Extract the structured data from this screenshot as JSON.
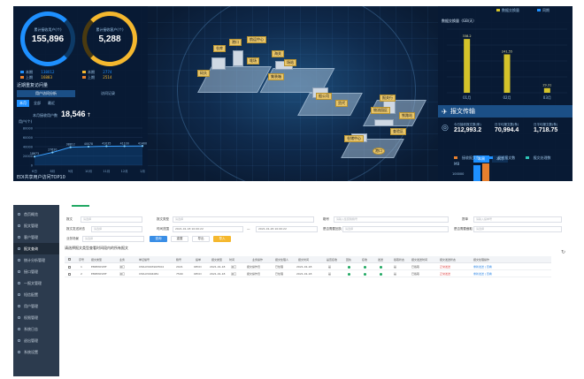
{
  "dashboard": {
    "ring1": {
      "label": "累计接收用户(个)",
      "value": "155,896",
      "color": "#1e90ff"
    },
    "ring2": {
      "label": "累计接收客户(个)",
      "value": "5,288",
      "color": "#f5b82e"
    },
    "ring_legend": [
      {
        "label": "本期",
        "value": "138012",
        "color": "#1e90ff"
      },
      {
        "label": "本期",
        "value": "2774",
        "color": "#f5b82e"
      },
      {
        "label": "上期",
        "value": "16883",
        "color": "#e8802e"
      },
      {
        "label": "上期",
        "value": "2514",
        "color": "#e8802e"
      }
    ],
    "visits_title": "近期重复访问量",
    "visit_tabs": [
      "用户访问分析",
      "访问记录"
    ],
    "visit_subtabs": [
      "本月",
      "全部",
      "最近"
    ],
    "big_stat": {
      "label": "本月接收用户数",
      "value": "18,546",
      "arrow": "↑"
    },
    "unit_label": "用户(个)",
    "bottom_title": "EDI共享用户访问TOP10",
    "map_labels": [
      "仓库",
      "港口",
      "堆场",
      "码头",
      "海关",
      "场站",
      "集装箱",
      "船公司",
      "货代",
      "报关行",
      "物流园区",
      "铁路站",
      "查验区",
      "仓储中心",
      "航运中心"
    ],
    "map_center_label": "港口",
    "right_title": "数据交换量（GB/天）",
    "right_legend": [
      "数据交换量",
      "同期"
    ],
    "right_unit": "数据交换量",
    "transfer_title": "报文传输",
    "transfer_stats": [
      {
        "label": "今日接收报文数(条)",
        "value": "212,993.2"
      },
      {
        "label": "日平均报文数(条)",
        "value": "70,994.4"
      },
      {
        "label": "日平均报文数(条)",
        "value": "1,718.75"
      }
    ],
    "transfer_buttons": [
      "本周",
      "本月"
    ],
    "transfer_legend": [
      "接收报文数",
      "发送报文数",
      "报文处理数"
    ],
    "transfer_unit": "MB",
    "transfer_ytick": "100000"
  },
  "chart_data": [
    {
      "type": "line",
      "title": "近期重复访问量",
      "ylabel": "用户(个)",
      "x": [
        "6日",
        "8月",
        "9月",
        "10月",
        "11月",
        "12月",
        "1月"
      ],
      "series": [
        {
          "values": [
            18673,
            27620,
            38812,
            40078,
            41035,
            41100,
            41400
          ]
        }
      ],
      "ylim": [
        0,
        80000
      ],
      "yticks": [
        0,
        20000,
        40000,
        60000,
        80000
      ]
    },
    {
      "type": "bar",
      "title": "数据交换量（GB/天）",
      "categories": [
        "01月",
        "02月",
        "03月"
      ],
      "series": [
        {
          "name": "数据交换量",
          "values": [
            338.2,
            241.55,
            29.31
          ]
        }
      ],
      "ylim": [
        0,
        400
      ]
    }
  ],
  "admin": {
    "sidebar": [
      "首页概览",
      "报文管理",
      "客户管理",
      "报文查询",
      "统计分析管理",
      "接口管理",
      "一报文管理",
      "短信配置",
      "用户管理",
      "权限管理",
      "系统日志",
      "退出管理",
      "系统设置"
    ],
    "filters": {
      "row1": [
        {
          "label": "报文",
          "placeholder": "请选择"
        },
        {
          "label": "报文类型",
          "placeholder": "请选择"
        },
        {
          "label": "箱号",
          "placeholder": "请输入集装箱箱号"
        },
        {
          "label": "提单",
          "placeholder": "请输入提单号"
        }
      ],
      "row2": [
        {
          "label": "报文发送状态",
          "placeholder": "请选择"
        },
        {
          "label": "时间范围",
          "value_start": "2021-01-18 10:00:22",
          "value_end": "2021-01-26 10:00:22"
        },
        {
          "label": "是否需要回执",
          "placeholder": "请选择"
        },
        {
          "label": "是否需要截取",
          "placeholder": "请选择"
        }
      ],
      "row3": [
        {
          "label": "业务场景",
          "placeholder": "请选择"
        }
      ]
    },
    "buttons": {
      "search": "查询",
      "reset": "重置",
      "export": "导出",
      "import": "导入"
    },
    "table_title": "请选择报文类型查看时间段内的所有报文",
    "columns": [
      "序号",
      "报文类型",
      "业务",
      "单证编号",
      "箱号",
      "提单",
      "报文类型",
      "时间",
      "业务操作",
      "报文处理人",
      "报文时间",
      "是否接收",
      "回执",
      "接收",
      "发送",
      "截取状态",
      "报文发送时间",
      "报文发送状态",
      "报文处理操作"
    ],
    "rows": [
      [
        "1",
        "EMPMOVMT",
        "进口",
        "CMAU3003923504",
        "2021",
        "OECD",
        "2021-01-18",
        "进口",
        "报文操作员",
        "已处理",
        "2021-01-18",
        "是",
        "是",
        "是",
        "已截取",
        "正常发送",
        "重新发送 | 查看"
      ],
      [
        "2",
        "EMPMOVMT",
        "进口",
        "CMAU3004081",
        "7590",
        "OECD",
        "2021-01-18",
        "进口",
        "报文操作员",
        "已处理",
        "2021-01-18",
        "是",
        "是",
        "是",
        "已截取",
        "正常发送",
        "重新发送 | 查看"
      ]
    ]
  }
}
